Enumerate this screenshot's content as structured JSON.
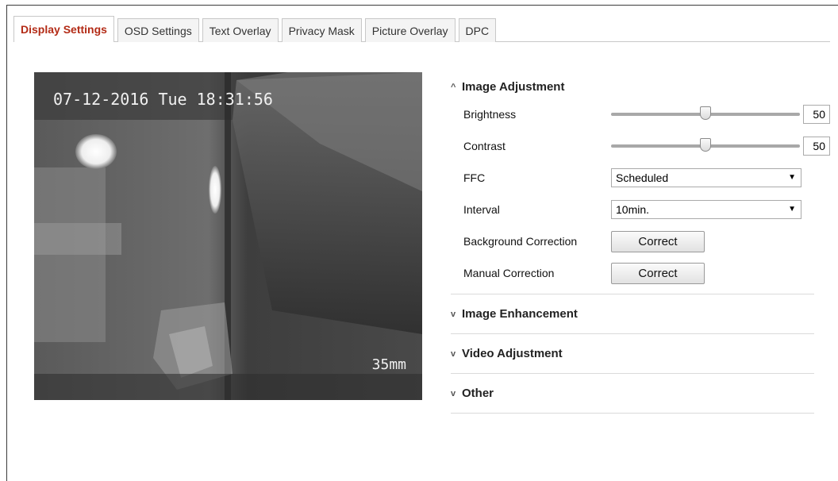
{
  "tabs": [
    {
      "label": "Display Settings",
      "active": true
    },
    {
      "label": "OSD Settings",
      "active": false
    },
    {
      "label": "Text Overlay",
      "active": false
    },
    {
      "label": "Privacy Mask",
      "active": false
    },
    {
      "label": "Picture Overlay",
      "active": false
    },
    {
      "label": "DPC",
      "active": false
    }
  ],
  "preview": {
    "timestamp": "07-12-2016 Tue 18:31:56",
    "zoom": "35mm"
  },
  "image_adjustment": {
    "title": "Image Adjustment",
    "expanded": true,
    "brightness": {
      "label": "Brightness",
      "value": "50",
      "level": 0.5
    },
    "contrast": {
      "label": "Contrast",
      "value": "50",
      "level": 0.5
    },
    "ffc": {
      "label": "FFC",
      "value": "Scheduled"
    },
    "interval": {
      "label": "Interval",
      "value": "10min."
    },
    "background_correction": {
      "label": "Background Correction",
      "button": "Correct"
    },
    "manual_correction": {
      "label": "Manual Correction",
      "button": "Correct"
    }
  },
  "sections": [
    {
      "title": "Image Enhancement",
      "expanded": false
    },
    {
      "title": "Video Adjustment",
      "expanded": false
    },
    {
      "title": "Other",
      "expanded": false
    }
  ],
  "colors": {
    "active_tab": "#b32b16"
  }
}
